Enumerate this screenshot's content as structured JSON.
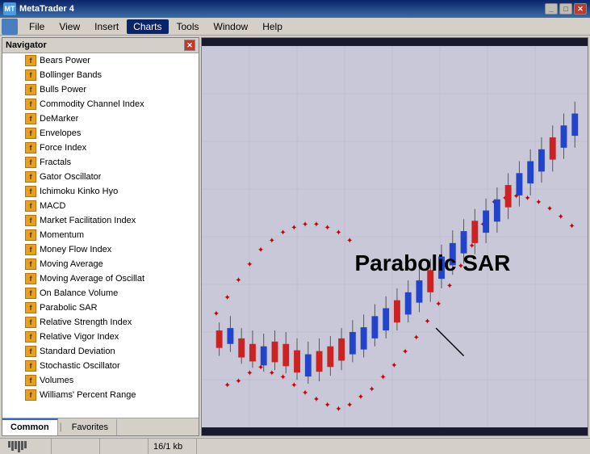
{
  "titleBar": {
    "title": "MetaTrader 4",
    "minimizeLabel": "_",
    "maximizeLabel": "□",
    "closeLabel": "✕"
  },
  "menuBar": {
    "appIcon": "MT",
    "items": [
      {
        "label": "File",
        "id": "file"
      },
      {
        "label": "View",
        "id": "view"
      },
      {
        "label": "Insert",
        "id": "insert"
      },
      {
        "label": "Charts",
        "id": "charts",
        "active": true
      },
      {
        "label": "Tools",
        "id": "tools"
      },
      {
        "label": "Window",
        "id": "window"
      },
      {
        "label": "Help",
        "id": "help"
      }
    ]
  },
  "navigator": {
    "title": "Navigator",
    "closeLabel": "✕",
    "items": [
      {
        "label": "Bears Power",
        "icon": "f"
      },
      {
        "label": "Bollinger Bands",
        "icon": "f"
      },
      {
        "label": "Bulls Power",
        "icon": "f"
      },
      {
        "label": "Commodity Channel Index",
        "icon": "f"
      },
      {
        "label": "DeMarker",
        "icon": "f"
      },
      {
        "label": "Envelopes",
        "icon": "f"
      },
      {
        "label": "Force Index",
        "icon": "f"
      },
      {
        "label": "Fractals",
        "icon": "f"
      },
      {
        "label": "Gator Oscillator",
        "icon": "f"
      },
      {
        "label": "Ichimoku Kinko Hyo",
        "icon": "f"
      },
      {
        "label": "MACD",
        "icon": "f"
      },
      {
        "label": "Market Facilitation Index",
        "icon": "f"
      },
      {
        "label": "Momentum",
        "icon": "f"
      },
      {
        "label": "Money Flow Index",
        "icon": "f"
      },
      {
        "label": "Moving Average",
        "icon": "f"
      },
      {
        "label": "Moving Average of Oscillat",
        "icon": "f"
      },
      {
        "label": "On Balance Volume",
        "icon": "f"
      },
      {
        "label": "Parabolic SAR",
        "icon": "f"
      },
      {
        "label": "Relative Strength Index",
        "icon": "f"
      },
      {
        "label": "Relative Vigor Index",
        "icon": "f"
      },
      {
        "label": "Standard Deviation",
        "icon": "f"
      },
      {
        "label": "Stochastic Oscillator",
        "icon": "f"
      },
      {
        "label": "Volumes",
        "icon": "f"
      },
      {
        "label": "Williams' Percent Range",
        "icon": "f"
      }
    ],
    "tabs": [
      {
        "label": "Common",
        "active": true
      },
      {
        "label": "Favorites"
      }
    ]
  },
  "chart": {
    "indicatorLabel": "Parabolic SAR",
    "backgroundColor": "#1a1a2e"
  },
  "statusBar": {
    "sections": [
      "",
      "",
      "",
      "16/1 kb"
    ]
  }
}
